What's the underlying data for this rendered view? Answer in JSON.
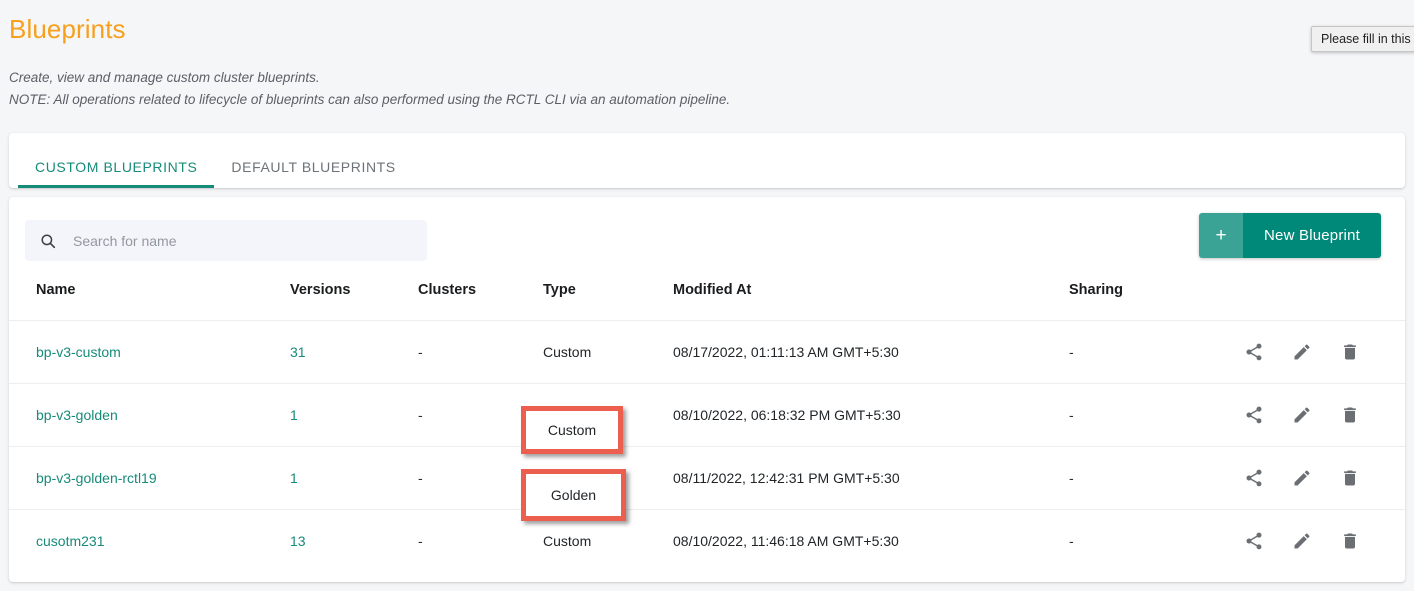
{
  "page": {
    "title": "Blueprints",
    "description_line1": "Create, view and manage custom cluster blueprints.",
    "description_line2": "NOTE: All operations related to lifecycle of blueprints can also performed using the RCTL CLI via an automation pipeline."
  },
  "tooltip": {
    "text": "Please fill in this field"
  },
  "tabs": [
    {
      "label": "CUSTOM BLUEPRINTS",
      "active": true
    },
    {
      "label": "DEFAULT BLUEPRINTS",
      "active": false
    }
  ],
  "toolbar": {
    "search_placeholder": "Search for name",
    "search_value": "",
    "search_icon": "search-icon",
    "new_button_plus": "+",
    "new_button_label": "New Blueprint"
  },
  "table": {
    "headers": [
      "Name",
      "Versions",
      "Clusters",
      "Type",
      "Modified At",
      "Sharing"
    ],
    "rows": [
      {
        "name": "bp-v3-custom",
        "versions": "31",
        "clusters": "-",
        "type": "Custom",
        "modified_at": "08/17/2022, 01:11:13 AM GMT+5:30",
        "sharing": "-"
      },
      {
        "name": "bp-v3-golden",
        "versions": "1",
        "clusters": "-",
        "type": "Custom",
        "modified_at": "08/10/2022, 06:18:32 PM GMT+5:30",
        "sharing": "-"
      },
      {
        "name": "bp-v3-golden-rctl19",
        "versions": "1",
        "clusters": "-",
        "type": "Golden",
        "modified_at": "08/11/2022, 12:42:31 PM GMT+5:30",
        "sharing": "-"
      },
      {
        "name": "cusotm231",
        "versions": "13",
        "clusters": "-",
        "type": "Custom",
        "modified_at": "08/10/2022, 11:46:18 AM GMT+5:30",
        "sharing": "-"
      }
    ],
    "row_actions": [
      "share-icon",
      "edit-icon",
      "delete-icon"
    ]
  },
  "highlights": [
    {
      "label": "Custom",
      "border_color": "#ec5f4f"
    },
    {
      "label": "Golden",
      "border_color": "#ec5f4f"
    }
  ],
  "colors": {
    "title": "#f7a01d",
    "accent_teal": "#178b7a",
    "button_teal": "#008878",
    "button_teal_light": "#3aa396",
    "highlight_red": "#ec5f4f",
    "page_bg": "#f5f6f8"
  }
}
